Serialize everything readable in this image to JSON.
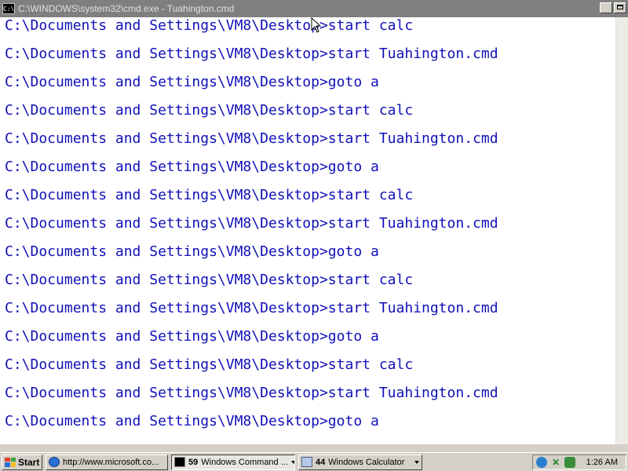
{
  "window": {
    "title": "C:\\WINDOWS\\system32\\cmd.exe - Tuahington.cmd",
    "icon_label": "C:\\"
  },
  "console": {
    "text_color": "#1010b8",
    "background": "#ffffff",
    "lines": [
      "C:\\Documents and Settings\\VM8\\Desktop>start calc",
      "C:\\Documents and Settings\\VM8\\Desktop>start Tuahington.cmd",
      "C:\\Documents and Settings\\VM8\\Desktop>goto a",
      "C:\\Documents and Settings\\VM8\\Desktop>start calc",
      "C:\\Documents and Settings\\VM8\\Desktop>start Tuahington.cmd",
      "C:\\Documents and Settings\\VM8\\Desktop>goto a",
      "C:\\Documents and Settings\\VM8\\Desktop>start calc",
      "C:\\Documents and Settings\\VM8\\Desktop>start Tuahington.cmd",
      "C:\\Documents and Settings\\VM8\\Desktop>goto a",
      "C:\\Documents and Settings\\VM8\\Desktop>start calc",
      "C:\\Documents and Settings\\VM8\\Desktop>start Tuahington.cmd",
      "C:\\Documents and Settings\\VM8\\Desktop>goto a",
      "C:\\Documents and Settings\\VM8\\Desktop>start calc",
      "C:\\Documents and Settings\\VM8\\Desktop>start Tuahington.cmd",
      "C:\\Documents and Settings\\VM8\\Desktop>goto a"
    ]
  },
  "taskbar": {
    "start_label": "Start",
    "tasks": [
      {
        "label": "http://www.microsoft.co...",
        "icon": "ie-icon",
        "count": ""
      },
      {
        "label": "Windows Command ...",
        "icon": "cmd-icon",
        "count": "59"
      },
      {
        "label": "Windows Calculator",
        "icon": "calculator-icon",
        "count": "44"
      }
    ],
    "clock": "1:26 AM"
  }
}
